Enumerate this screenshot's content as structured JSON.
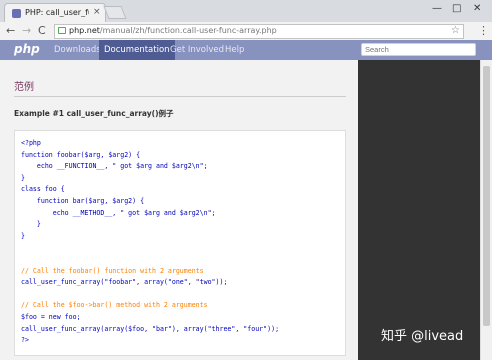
{
  "browser": {
    "tab_title": "PHP: call_user_func_arr",
    "tab_close": "×",
    "url_host": "php.net",
    "url_path": "/manual/zh/function.call-user-func-array.php",
    "win_min": "—",
    "win_max": "□",
    "win_close": "✕",
    "back": "←",
    "forward": "→",
    "reload": "C",
    "star": "☆",
    "menu": "⋮"
  },
  "nav": {
    "logo": "php",
    "items": [
      "Downloads",
      "Documentation",
      "Get Involved",
      "Help"
    ],
    "active": "Documentation",
    "search_placeholder": "Search"
  },
  "content": {
    "section_title": "范例",
    "example_title": "Example #1 call_user_func_array()例子",
    "code_lines": [
      "<?php",
      "function foobar($arg, $arg2) {",
      "    echo __FUNCTION__, \" got $arg and $arg2\\n\";",
      "}",
      "class foo {",
      "    function bar($arg, $arg2) {",
      "        echo __METHOD__, \" got $arg and $arg2\\n\";",
      "    }",
      "}",
      "",
      "",
      "// Call the foobar() function with 2 arguments",
      "call_user_func_array(\"foobar\", array(\"one\", \"two\"));",
      "",
      "// Call the $foo->bar() method with 2 arguments",
      "$foo = new foo;",
      "call_user_func_array(array($foo, \"bar\"), array(\"three\", \"four\"));",
      "?>"
    ]
  },
  "watermark": "知乎 @livead"
}
